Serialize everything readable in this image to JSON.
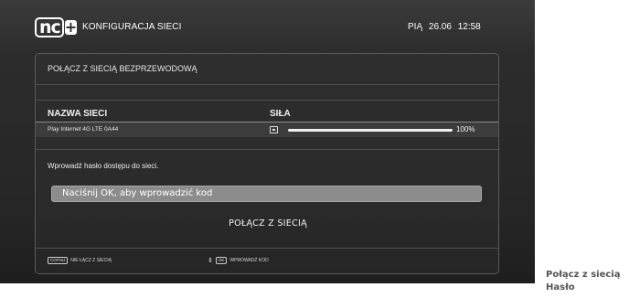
{
  "header": {
    "logo_text": "nc",
    "logo_plus": "+",
    "title": "KONFIGURACJA SIECI",
    "day": "PIĄ",
    "date": "26.06",
    "time": "12:58"
  },
  "panel": {
    "title": "POŁĄCZ Z SIECIĄ BEZPRZEWODOWĄ",
    "columns": {
      "name": "NAZWA SIECI",
      "strength": "SIŁA"
    },
    "network": {
      "name": "Play Internet 4G LTE 0A44",
      "secured_icon": "lock-icon",
      "signal_fraction": 1.0,
      "signal_label": "100%"
    },
    "prompt": "Wprowadź hasło dostępu do sieci.",
    "password_field": {
      "value": "Naciśnij OK, aby wprowadzić kod"
    },
    "connect_button": "POŁĄCZ Z SIECIĄ",
    "hints": {
      "back_key": "COFNIJ",
      "back_label": "NIE ŁĄCZ Z SIECIĄ",
      "nav_icon": "up-down-arrows-icon",
      "ok_key": "OK",
      "ok_label": "WPROWADŹ KOD"
    }
  },
  "caption": {
    "line1": "Połącz z siecią",
    "line2": "Hasło"
  },
  "colors": {
    "screen_bg": "#2c2c2c",
    "field_bg": "#8c8c8c",
    "text": "#ffffff"
  }
}
